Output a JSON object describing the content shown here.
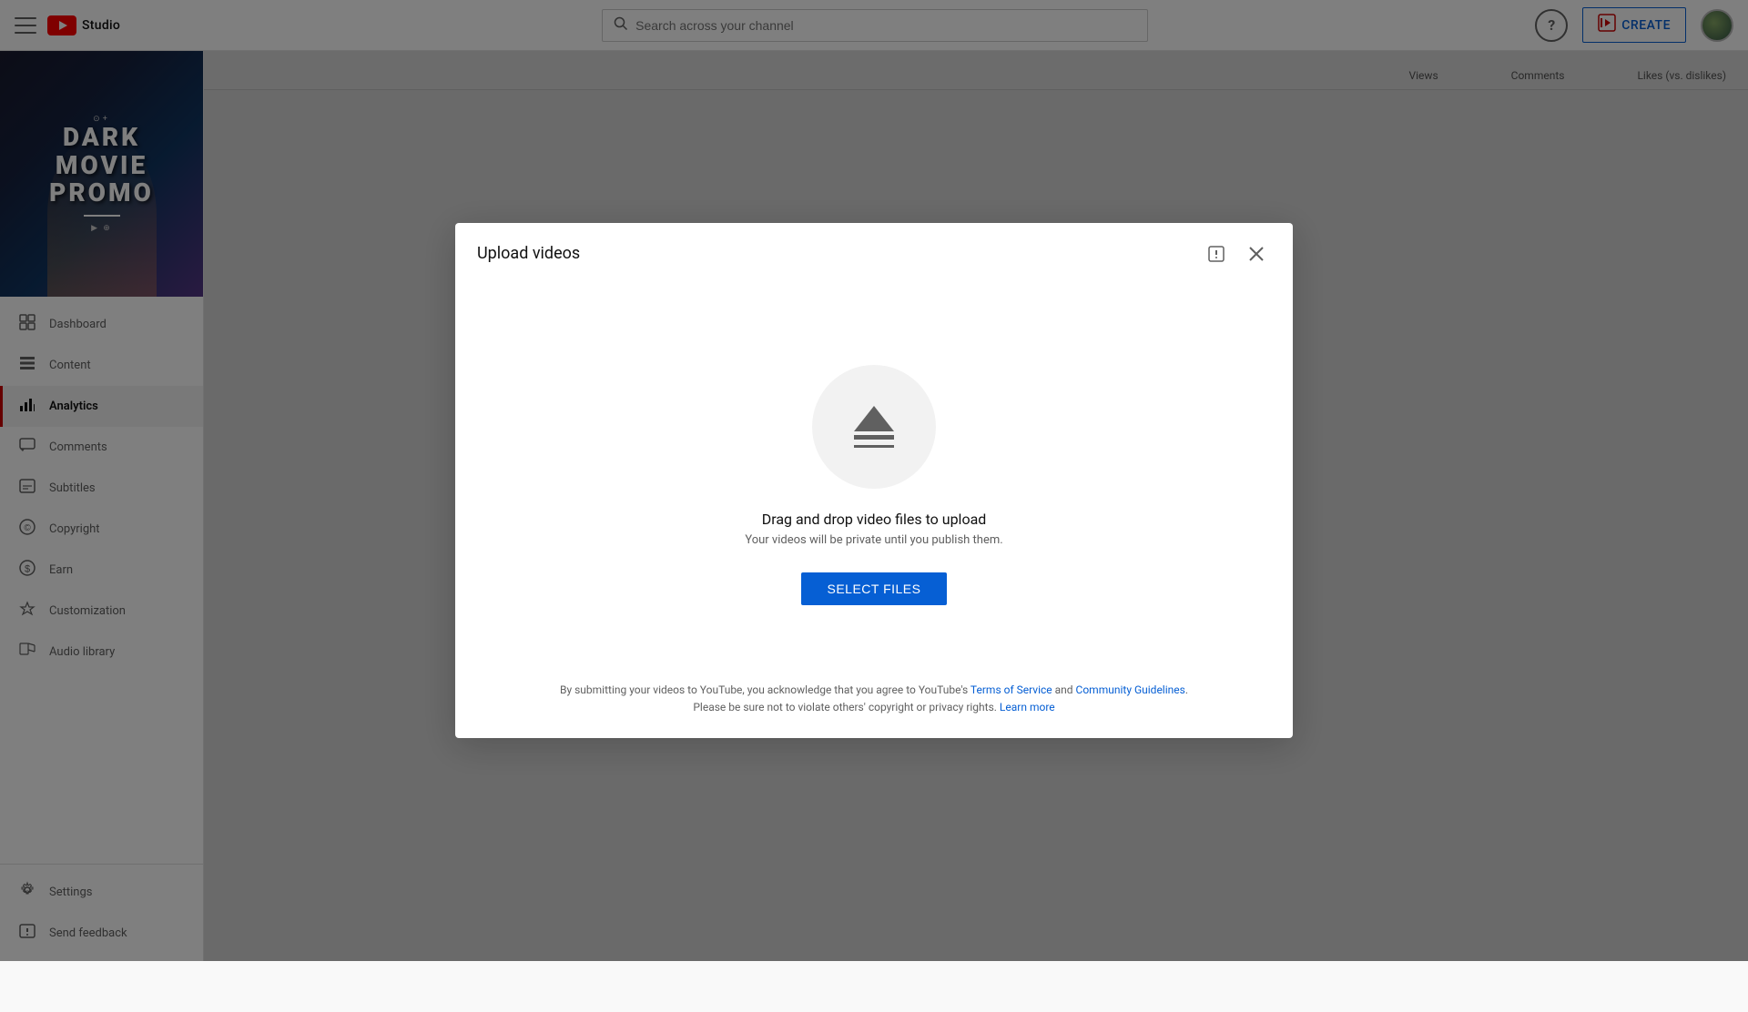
{
  "header": {
    "hamburger_label": "menu",
    "logo_icon": "▶",
    "studio_label": "Studio",
    "search_placeholder": "Search across your channel",
    "help_label": "?",
    "create_label": "CREATE",
    "avatar_label": "user avatar"
  },
  "sidebar": {
    "channel": {
      "title": "DARK\nMOVIE\nPROMO",
      "subtitle": "⊕+"
    },
    "nav_items": [
      {
        "id": "dashboard",
        "label": "Dashboard",
        "icon": "⊞"
      },
      {
        "id": "content",
        "label": "Content",
        "icon": "▦"
      },
      {
        "id": "analytics",
        "label": "Analytics",
        "icon": "📊",
        "active": true
      },
      {
        "id": "comments",
        "label": "Comments",
        "icon": "💬"
      },
      {
        "id": "subtitles",
        "label": "Subtitles",
        "icon": "⊟"
      },
      {
        "id": "copyright",
        "label": "Copyright",
        "icon": "©"
      },
      {
        "id": "earn",
        "label": "Earn",
        "icon": "$"
      },
      {
        "id": "customization",
        "label": "Customization",
        "icon": "✏"
      },
      {
        "id": "audio-library",
        "label": "Audio library",
        "icon": "🎵"
      }
    ],
    "bottom_items": [
      {
        "id": "settings",
        "label": "Settings",
        "icon": "⚙"
      },
      {
        "id": "send-feedback",
        "label": "Send feedback",
        "icon": "❗"
      }
    ]
  },
  "main": {
    "columns": {
      "views_label": "Views",
      "comments_label": "Comments",
      "likes_label": "Likes (vs. dislikes)"
    }
  },
  "modal": {
    "title": "Upload videos",
    "drag_drop_text": "Drag and drop video files to upload",
    "privacy_text": "Your videos will be private until you publish them.",
    "select_files_label": "SELECT FILES",
    "footer_text_before": "By submitting your videos to YouTube, you acknowledge that you agree to YouTube's ",
    "tos_label": "Terms of Service",
    "footer_and": " and ",
    "guidelines_label": "Community Guidelines",
    "footer_text_after": ".",
    "footer_line2_before": "Please be sure not to violate others' copyright or privacy rights. ",
    "learn_more_label": "Learn more",
    "close_label": "✕",
    "alert_label": "!"
  }
}
